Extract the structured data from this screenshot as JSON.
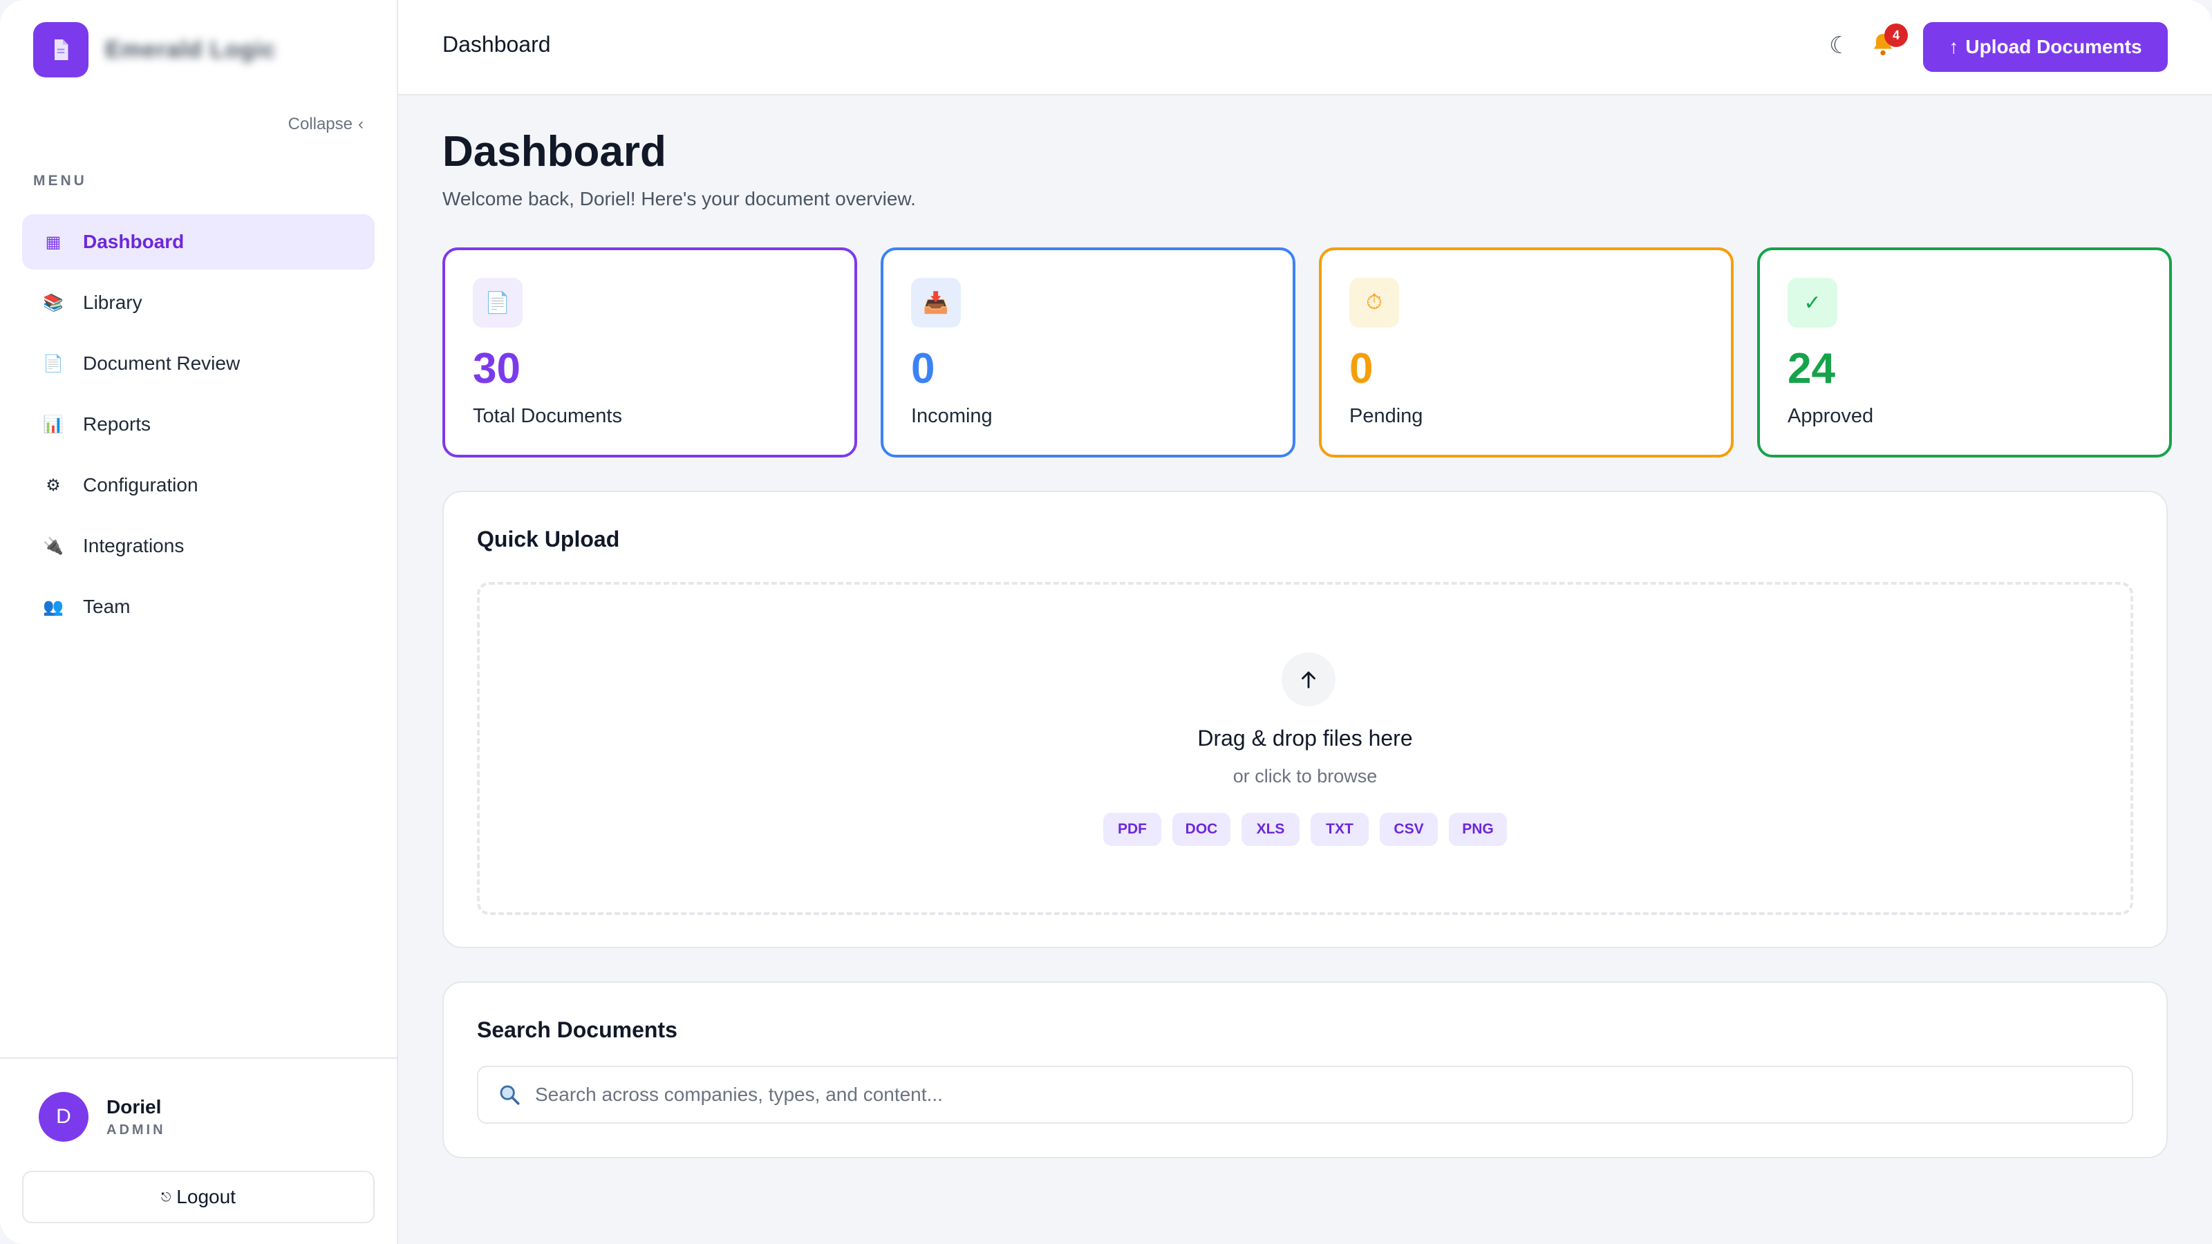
{
  "sidebar": {
    "brand_name": "Emerald Logic",
    "collapse_label": "Collapse",
    "collapse_chevron": "‹",
    "menu_label": "MENU",
    "items": [
      {
        "label": "Dashboard",
        "icon": "grid-icon",
        "glyph": "▦",
        "active": true
      },
      {
        "label": "Library",
        "icon": "books-icon",
        "glyph": "📚",
        "active": false
      },
      {
        "label": "Document Review",
        "icon": "document-icon",
        "glyph": "📄",
        "active": false
      },
      {
        "label": "Reports",
        "icon": "bar-chart-icon",
        "glyph": "📊",
        "active": false
      },
      {
        "label": "Configuration",
        "icon": "gear-icon",
        "glyph": "⚙",
        "active": false
      },
      {
        "label": "Integrations",
        "icon": "plug-icon",
        "glyph": "🔌",
        "active": false
      },
      {
        "label": "Team",
        "icon": "users-icon",
        "glyph": "👥",
        "active": false
      }
    ],
    "user": {
      "initial": "D",
      "name": "Doriel",
      "role": "ADMIN"
    },
    "logout_label": "Logout",
    "logout_glyph": "⎋"
  },
  "topbar": {
    "title": "Dashboard",
    "theme_glyph": "☾",
    "notification_count": "4",
    "upload_label": "Upload Documents",
    "upload_glyph": "↑"
  },
  "page": {
    "title": "Dashboard",
    "subtitle": "Welcome back, Doriel! Here's your document overview."
  },
  "stats": [
    {
      "value": "30",
      "label": "Total Documents",
      "icon": "document-icon",
      "glyph": "📄",
      "color": "#7c3aed",
      "bg": "#f1edfd"
    },
    {
      "value": "0",
      "label": "Incoming",
      "icon": "inbox-tray-icon",
      "glyph": "📥",
      "color": "#3b82f6",
      "bg": "#e6eefd"
    },
    {
      "value": "0",
      "label": "Pending",
      "icon": "stopwatch-icon",
      "glyph": "⏱",
      "color": "#f59e0b",
      "bg": "#fdf4dc"
    },
    {
      "value": "24",
      "label": "Approved",
      "icon": "check-icon",
      "glyph": "✓",
      "color": "#16a34a",
      "bg": "#dcfce7"
    }
  ],
  "quick_upload": {
    "title": "Quick Upload",
    "drop_title": "Drag & drop files here",
    "drop_subtitle": "or click to browse",
    "file_types": [
      "PDF",
      "DOC",
      "XLS",
      "TXT",
      "CSV",
      "PNG"
    ]
  },
  "search": {
    "title": "Search Documents",
    "placeholder": "Search across companies, types, and content..."
  },
  "colors": {
    "accent": "#7c3aed",
    "badge": "#dc2626"
  }
}
